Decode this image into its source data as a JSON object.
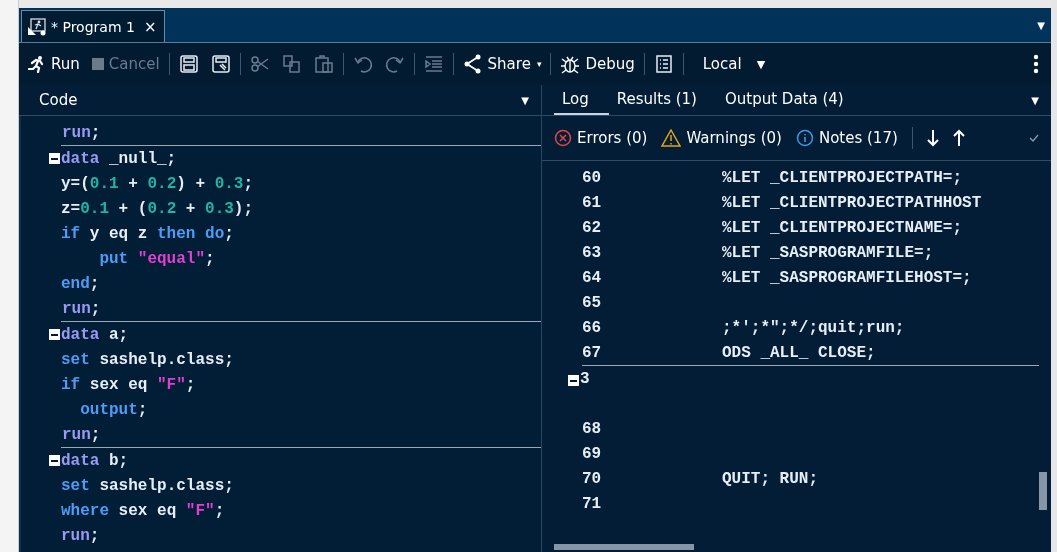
{
  "window": {
    "tab": {
      "title": "* Program 1",
      "close": "×"
    },
    "menu_caret": "▼"
  },
  "toolbar": [
    {
      "kind": "run",
      "label": "Run",
      "disabled": false
    },
    {
      "kind": "cancel",
      "label": "Cancel",
      "disabled": true
    },
    {
      "kind": "sep"
    },
    {
      "kind": "save",
      "disabled": false
    },
    {
      "kind": "save-as",
      "disabled": false
    },
    {
      "kind": "sep"
    },
    {
      "kind": "cut",
      "disabled": true
    },
    {
      "kind": "copy",
      "disabled": true
    },
    {
      "kind": "paste",
      "disabled": true
    },
    {
      "kind": "sep"
    },
    {
      "kind": "undo",
      "disabled": true
    },
    {
      "kind": "redo",
      "disabled": true
    },
    {
      "kind": "sep"
    },
    {
      "kind": "format",
      "disabled": true
    },
    {
      "kind": "sep"
    },
    {
      "kind": "share",
      "label": "Share",
      "caret": "▾",
      "disabled": false
    },
    {
      "kind": "sep"
    },
    {
      "kind": "debug",
      "label": "Debug",
      "disabled": false
    },
    {
      "kind": "sep"
    },
    {
      "kind": "list",
      "disabled": false
    },
    {
      "kind": "sep"
    },
    {
      "kind": "server",
      "label": "Local",
      "caret": "▼",
      "disabled": false
    }
  ],
  "code": {
    "title": "Code",
    "caret": "▼",
    "lines": [
      {
        "fold": false,
        "rule_below": true,
        "tokens": [
          {
            "kind": "step",
            "text": "run"
          },
          {
            "kind": "plain",
            "text": ";"
          }
        ]
      },
      {
        "fold": true,
        "rule_below": false,
        "tokens": [
          {
            "kind": "step",
            "text": "data"
          },
          {
            "kind": "plain",
            "text": " _null_;"
          }
        ]
      },
      {
        "fold": false,
        "rule_below": false,
        "tokens": [
          {
            "kind": "plain",
            "text": "y=("
          },
          {
            "kind": "num",
            "text": "0.1"
          },
          {
            "kind": "plain",
            "text": " + "
          },
          {
            "kind": "num",
            "text": "0.2"
          },
          {
            "kind": "plain",
            "text": ") + "
          },
          {
            "kind": "num",
            "text": "0.3"
          },
          {
            "kind": "plain",
            "text": ";"
          }
        ]
      },
      {
        "fold": false,
        "rule_below": false,
        "tokens": [
          {
            "kind": "plain",
            "text": "z="
          },
          {
            "kind": "num",
            "text": "0.1"
          },
          {
            "kind": "plain",
            "text": " + ("
          },
          {
            "kind": "num",
            "text": "0.2"
          },
          {
            "kind": "plain",
            "text": " + "
          },
          {
            "kind": "num",
            "text": "0.3"
          },
          {
            "kind": "plain",
            "text": ");"
          }
        ]
      },
      {
        "fold": false,
        "rule_below": false,
        "tokens": [
          {
            "kind": "kw",
            "text": "if"
          },
          {
            "kind": "plain",
            "text": " y eq z "
          },
          {
            "kind": "kw",
            "text": "then do"
          },
          {
            "kind": "plain",
            "text": ";"
          }
        ]
      },
      {
        "fold": false,
        "rule_below": false,
        "tokens": [
          {
            "kind": "kw",
            "text": "    put "
          },
          {
            "kind": "str",
            "text": "\"equal\""
          },
          {
            "kind": "plain",
            "text": ";"
          }
        ]
      },
      {
        "fold": false,
        "rule_below": false,
        "tokens": [
          {
            "kind": "kw",
            "text": "end"
          },
          {
            "kind": "plain",
            "text": ";"
          }
        ]
      },
      {
        "fold": false,
        "rule_below": true,
        "tokens": [
          {
            "kind": "step",
            "text": "run"
          },
          {
            "kind": "plain",
            "text": ";"
          }
        ]
      },
      {
        "fold": true,
        "rule_below": false,
        "tokens": [
          {
            "kind": "step",
            "text": "data"
          },
          {
            "kind": "plain",
            "text": " a;"
          }
        ]
      },
      {
        "fold": false,
        "rule_below": false,
        "tokens": [
          {
            "kind": "kw",
            "text": "set"
          },
          {
            "kind": "plain",
            "text": " sashelp.class;"
          }
        ]
      },
      {
        "fold": false,
        "rule_below": false,
        "tokens": [
          {
            "kind": "kw",
            "text": "if"
          },
          {
            "kind": "plain",
            "text": " sex eq "
          },
          {
            "kind": "str",
            "text": "\"F\""
          },
          {
            "kind": "plain",
            "text": ";"
          }
        ]
      },
      {
        "fold": false,
        "rule_below": false,
        "tokens": [
          {
            "kind": "kw",
            "text": "  output"
          },
          {
            "kind": "plain",
            "text": ";"
          }
        ]
      },
      {
        "fold": false,
        "rule_below": true,
        "tokens": [
          {
            "kind": "step",
            "text": "run"
          },
          {
            "kind": "plain",
            "text": ";"
          }
        ]
      },
      {
        "fold": true,
        "rule_below": false,
        "tokens": [
          {
            "kind": "step",
            "text": "data"
          },
          {
            "kind": "plain",
            "text": " b;"
          }
        ]
      },
      {
        "fold": false,
        "rule_below": false,
        "tokens": [
          {
            "kind": "kw",
            "text": "set"
          },
          {
            "kind": "plain",
            "text": " sashelp.class;"
          }
        ]
      },
      {
        "fold": false,
        "rule_below": false,
        "tokens": [
          {
            "kind": "kw",
            "text": "where"
          },
          {
            "kind": "plain",
            "text": " sex eq "
          },
          {
            "kind": "str",
            "text": "\"F\""
          },
          {
            "kind": "plain",
            "text": ";"
          }
        ]
      },
      {
        "fold": false,
        "rule_below": false,
        "tokens": [
          {
            "kind": "step",
            "text": "run"
          },
          {
            "kind": "plain",
            "text": ";"
          }
        ]
      }
    ]
  },
  "tabs": [
    {
      "label": "Log",
      "selected": true
    },
    {
      "label": "Results (1)",
      "selected": false
    },
    {
      "label": "Output Data (4)",
      "selected": false
    }
  ],
  "tabs_caret": "▼",
  "log_filters": [
    {
      "kind": "error",
      "label": "Errors (0)"
    },
    {
      "kind": "warning",
      "label": "Warnings (0)"
    },
    {
      "kind": "note",
      "label": "Notes (17)"
    }
  ],
  "log": [
    {
      "kind": "line",
      "number": "60",
      "text": "%LET _CLIENTPROJECTPATH=;",
      "rule_below": false
    },
    {
      "kind": "line",
      "number": "61",
      "text": "%LET _CLIENTPROJECTPATHHOST",
      "rule_below": false
    },
    {
      "kind": "line",
      "number": "62",
      "text": "%LET _CLIENTPROJECTNAME=;",
      "rule_below": false
    },
    {
      "kind": "line",
      "number": "63",
      "text": "%LET _SASPROGRAMFILE=;",
      "rule_below": false
    },
    {
      "kind": "line",
      "number": "64",
      "text": "%LET _SASPROGRAMFILEHOST=;",
      "rule_below": false
    },
    {
      "kind": "line",
      "number": "65",
      "rule_below": false
    },
    {
      "kind": "line",
      "number": "66",
      "text": ";*';*\";*/;quit;run;",
      "rule_below": false
    },
    {
      "kind": "line",
      "number": "67",
      "text": "ODS _ALL_ CLOSE;",
      "rule_below": true
    },
    {
      "kind": "fold",
      "number": "3"
    },
    {
      "kind": "line",
      "number": "68",
      "rule_below": false
    },
    {
      "kind": "line",
      "number": "69",
      "rule_below": false
    },
    {
      "kind": "line",
      "number": "70",
      "text": "QUIT; RUN;",
      "rule_below": false
    },
    {
      "kind": "line",
      "number": "71",
      "rule_below": false
    }
  ]
}
